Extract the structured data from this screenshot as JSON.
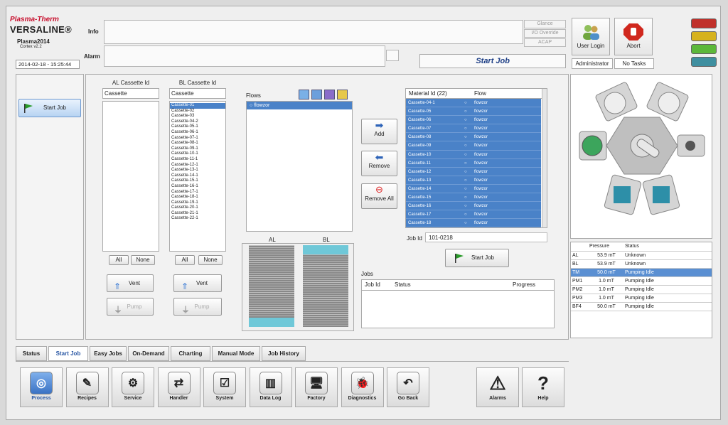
{
  "header": {
    "brand": "Plasma-Therm",
    "product": "VERSALINE®",
    "app": "Plasma2014",
    "version": "Cortex v2.2",
    "datetime": "2014-02-18 - 15:25:44",
    "info_label": "Info",
    "alarm_label": "Alarm",
    "glance": "Glance",
    "io_override": "I/O Override",
    "acap": "ACAP",
    "current_screen": "Start Job",
    "user_login": "User Login",
    "abort": "Abort",
    "user": "Administrator",
    "tasks": "No Tasks"
  },
  "lamps": [
    "#c0302a",
    "#d6b21e",
    "#5cb83a",
    "#3f8fa0"
  ],
  "left": {
    "start_job": "Start Job"
  },
  "al": {
    "title": "AL Cassette Id",
    "value": "Cassette",
    "items": [],
    "all": "All",
    "none": "None",
    "vent": "Vent",
    "pump": "Pump"
  },
  "bl": {
    "title": "BL Cassette Id",
    "value": "Cassette",
    "items": [
      "Cassette-01",
      "Cassette-02",
      "Cassette-03",
      "Cassette-04-2",
      "Cassette-05-1",
      "Cassette-06-1",
      "Cassette-07-1",
      "Cassette-08-1",
      "Cassette-09-1",
      "Cassette-10-1",
      "Cassette-11-1",
      "Cassette-12-1",
      "Cassette-13-1",
      "Cassette-14-1",
      "Cassette-15-1",
      "Cassette-16-1",
      "Cassette-17-1",
      "Cassette-18-1",
      "Cassette-19-1",
      "Cassette-20-1",
      "Cassette-21-1",
      "Cassette-22-1"
    ],
    "all": "All",
    "none": "None",
    "vent": "Vent",
    "pump": "Pump"
  },
  "flows": {
    "title": "Flows",
    "items": [
      "flowzor"
    ]
  },
  "gauges": {
    "al": "AL",
    "bl": "BL",
    "ticks": [
      "25",
      "20",
      "15",
      "10",
      "5",
      "0"
    ]
  },
  "actions": {
    "add": "Add",
    "remove": "Remove",
    "remove_all": "Remove All"
  },
  "materials": {
    "col_id": "Material Id (22)",
    "col_flow": "Flow",
    "rows": [
      [
        "Cassette-04-1",
        "flowzor"
      ],
      [
        "Cassette-05",
        "flowzor"
      ],
      [
        "Cassette-06",
        "flowzor"
      ],
      [
        "Cassette-07",
        "flowzor"
      ],
      [
        "Cassette-08",
        "flowzor"
      ],
      [
        "Cassette-09",
        "flowzor"
      ],
      [
        "Cassette-10",
        "flowzor"
      ],
      [
        "Cassette-11",
        "flowzor"
      ],
      [
        "Cassette-12",
        "flowzor"
      ],
      [
        "Cassette-13",
        "flowzor"
      ],
      [
        "Cassette-14",
        "flowzor"
      ],
      [
        "Cassette-15",
        "flowzor"
      ],
      [
        "Cassette-16",
        "flowzor"
      ],
      [
        "Cassette-17",
        "flowzor"
      ],
      [
        "Cassette-18",
        "flowzor"
      ]
    ]
  },
  "job": {
    "label": "Job Id",
    "value": "101-0218",
    "start": "Start Job"
  },
  "jobs": {
    "title": "Jobs",
    "col_id": "Job Id",
    "col_status": "Status",
    "col_progress": "Progress"
  },
  "pressure": {
    "col_p": "Pressure",
    "col_s": "Status",
    "rows": [
      [
        "AL",
        "53.9 mT",
        "Unknown"
      ],
      [
        "BL",
        "53.9 mT",
        "Unknown"
      ],
      [
        "TM",
        "50.0 mT",
        "Pumping Idle"
      ],
      [
        "PM1",
        "1.0 mT",
        "Pumping Idle"
      ],
      [
        "PM2",
        "1.0 mT",
        "Pumping Idle"
      ],
      [
        "PM3",
        "1.0 mT",
        "Pumping Idle"
      ],
      [
        "BF4",
        "50.0 mT",
        "Pumping Idle"
      ]
    ]
  },
  "tabs": [
    "Status",
    "Start Job",
    "Easy Jobs",
    "On-Demand",
    "Charting",
    "Manual Mode",
    "Job History"
  ],
  "nav": [
    "Process",
    "Recipes",
    "Service",
    "Handler",
    "System",
    "Data Log",
    "Factory",
    "Diagnostics",
    "Go Back"
  ],
  "nav_right": [
    "Alarms",
    "Help"
  ]
}
